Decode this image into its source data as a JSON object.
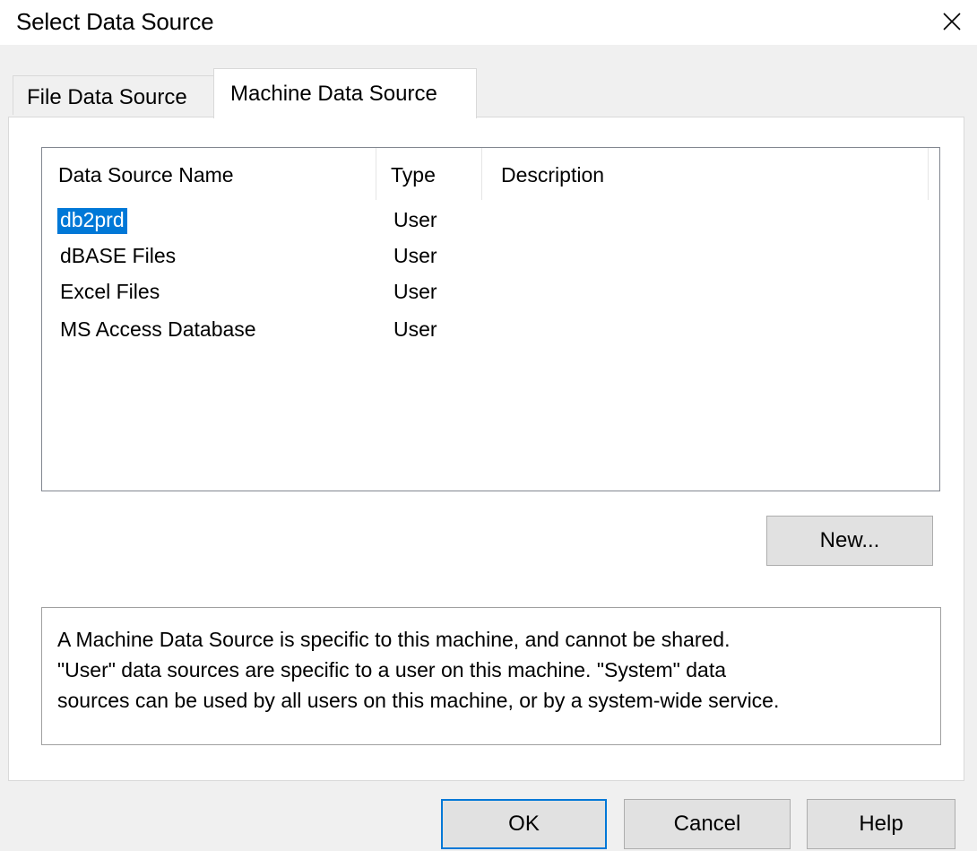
{
  "window": {
    "title": "Select Data Source",
    "close_icon": "close-icon"
  },
  "tabs": [
    {
      "label": "File Data Source",
      "active": false
    },
    {
      "label": "Machine Data Source",
      "active": true
    }
  ],
  "list": {
    "columns": [
      "Data Source Name",
      "Type",
      "Description"
    ],
    "rows": [
      {
        "name": "db2prd",
        "type": "User",
        "description": "",
        "selected": true
      },
      {
        "name": "dBASE Files",
        "type": "User",
        "description": "",
        "selected": false
      },
      {
        "name": "Excel Files",
        "type": "User",
        "description": "",
        "selected": false
      },
      {
        "name": "MS Access Database",
        "type": "User",
        "description": "",
        "selected": false
      }
    ]
  },
  "buttons": {
    "new_label": "New...",
    "ok_label": "OK",
    "cancel_label": "Cancel",
    "help_label": "Help"
  },
  "description": {
    "lines": [
      "A Machine Data Source is specific to this machine, and cannot be shared.",
      "\"User\" data sources are specific to a user on this machine.  \"System\" data",
      "sources can be used by all users on this machine, or by a system-wide service."
    ]
  },
  "colors": {
    "selection": "#0078d7",
    "default_button_border": "#0078d7",
    "dialog_background": "#f0f0f0"
  }
}
